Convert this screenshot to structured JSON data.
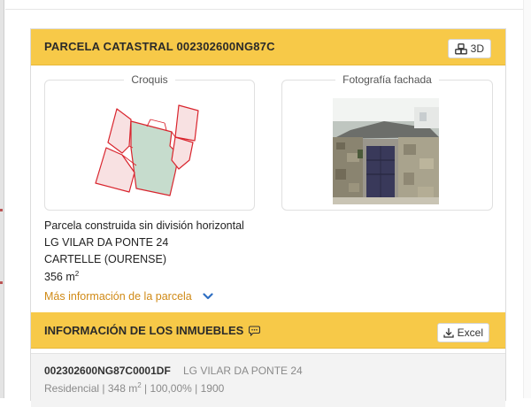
{
  "parcel_header": {
    "title": "PARCELA CATASTRAL 002302600NG87C",
    "btn_3d": "3D"
  },
  "panels": {
    "sketch_label": "Croquis",
    "photo_label": "Fotografía fachada"
  },
  "parcel_info": {
    "line1": "Parcela construida sin división horizontal",
    "line2": "LG VILAR DA PONTE 24",
    "line3": "CARTELLE (OURENSE)",
    "area_value": "356 m",
    "area_unit_sup": "2",
    "more_link": "Más información de la parcela"
  },
  "properties_header": {
    "title": "INFORMACIÓN DE LOS INMUEBLES",
    "excel_label": "Excel"
  },
  "properties": [
    {
      "ref": "002302600NG87C0001DF",
      "address": "LG VILAR DA PONTE 24",
      "use": "Residencial",
      "area": "348 m",
      "area_sup": "2",
      "share": "100,00%",
      "year": "1900"
    }
  ],
  "colors": {
    "header_bg": "#f7c948",
    "link": "#d08a16",
    "chevron": "#2f6fc3",
    "sketch_outline": "#d9252e",
    "sketch_fill": "#f8e1e2",
    "sketch_highlight": "#c6dccd"
  },
  "icons": {
    "btn_3d_icon": "cubes-icon",
    "excel_icon": "download-icon",
    "comment_icon": "comment-icon",
    "more_icon": "chevron-down-icon"
  }
}
